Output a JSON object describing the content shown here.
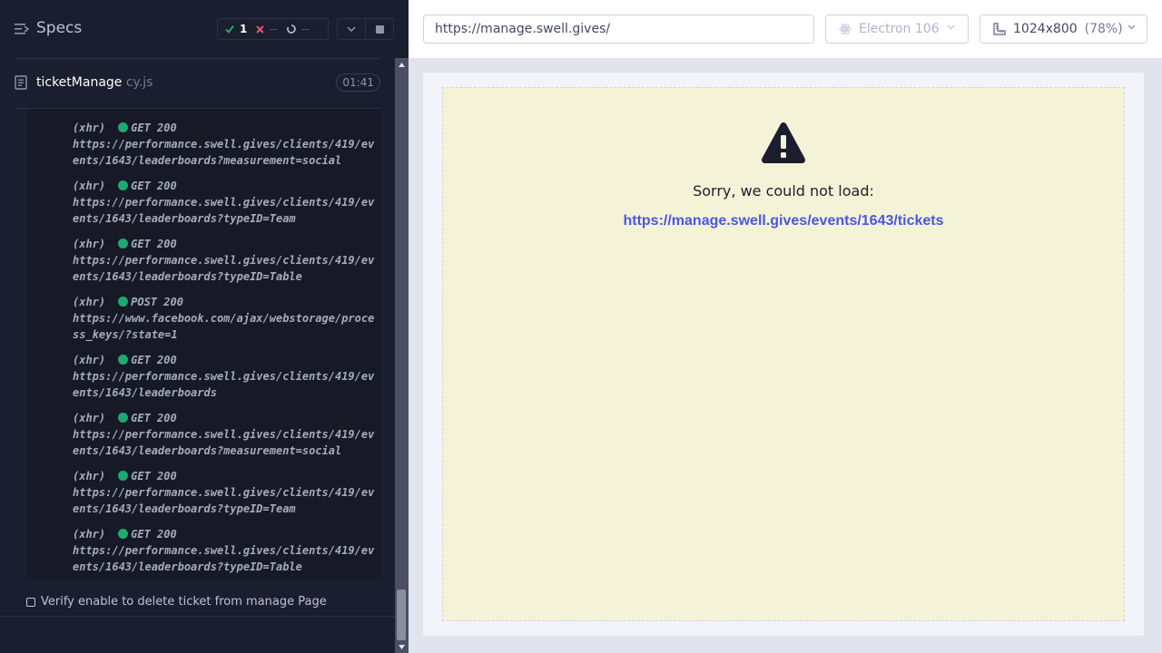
{
  "reporter": {
    "title": "Specs",
    "stats": {
      "passed": "1",
      "failed": "--",
      "pending": "--"
    },
    "spec_file": {
      "name": "ticketManage",
      "ext": " cy.js",
      "duration": "01:41"
    },
    "log": [
      {
        "kind": "(xhr)",
        "method": "GET 200",
        "url": "https://performance.swell.gives/clients/419/events/1643/leaderboards?measurement=social"
      },
      {
        "kind": "(xhr)",
        "method": "GET 200",
        "url": "https://performance.swell.gives/clients/419/events/1643/leaderboards?typeID=Team"
      },
      {
        "kind": "(xhr)",
        "method": "GET 200",
        "url": "https://performance.swell.gives/clients/419/events/1643/leaderboards?typeID=Table"
      },
      {
        "kind": "(xhr)",
        "method": "POST 200",
        "url": "https://www.facebook.com/ajax/webstorage/process_keys/?state=1"
      },
      {
        "kind": "(xhr)",
        "method": "GET 200",
        "url": "https://performance.swell.gives/clients/419/events/1643/leaderboards"
      },
      {
        "kind": "(xhr)",
        "method": "GET 200",
        "url": "https://performance.swell.gives/clients/419/events/1643/leaderboards?measurement=social"
      },
      {
        "kind": "(xhr)",
        "method": "GET 200",
        "url": "https://performance.swell.gives/clients/419/events/1643/leaderboards?typeID=Team"
      },
      {
        "kind": "(xhr)",
        "method": "GET 200",
        "url": "https://performance.swell.gives/clients/419/events/1643/leaderboards?typeID=Table"
      }
    ],
    "test_title": "Verify enable to delete ticket from manage Page"
  },
  "aut": {
    "url": "https://manage.swell.gives/",
    "browser": "Electron 106",
    "viewport": "1024x800",
    "scale": "(78%)",
    "error_message": "Sorry, we could not load:",
    "failed_url": "https://manage.swell.gives/events/1643/tickets"
  },
  "colors": {
    "pass": "#1fa971",
    "fail": "#e45770",
    "link": "#4956e3",
    "error_bg": "#f5f3d7"
  }
}
